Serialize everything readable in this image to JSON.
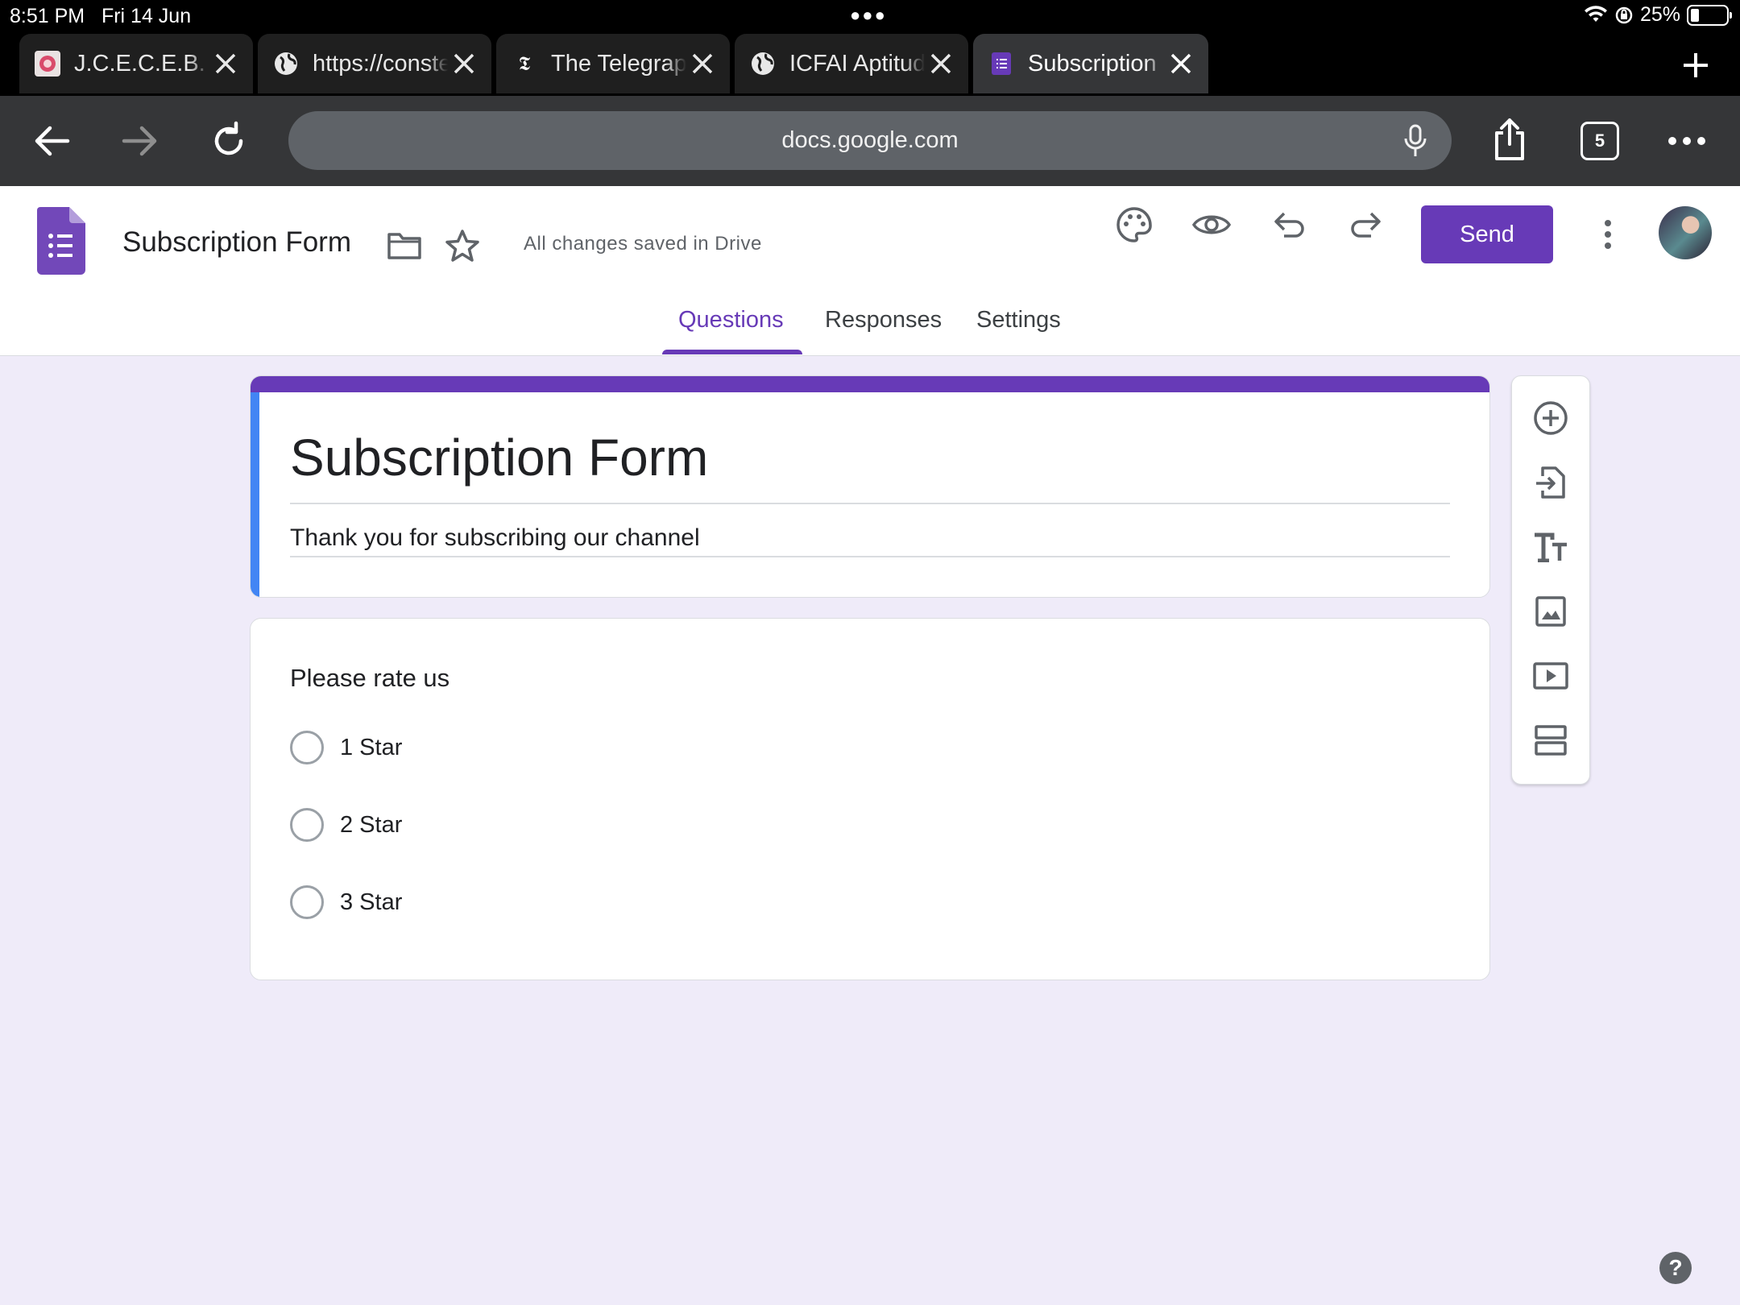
{
  "status_bar": {
    "time": "8:51 PM",
    "date": "Fri 14 Jun",
    "battery": "25%"
  },
  "browser": {
    "tabs": [
      {
        "title": "J.C.E.C.E.B. || Result",
        "icon": "jceceb-favicon"
      },
      {
        "title": "https://constellationtrends",
        "icon": "globe-icon"
      },
      {
        "title": "The Telegraph - Telegraph India",
        "icon": "telegraph-favicon"
      },
      {
        "title": "ICFAI Aptitude Test Result",
        "icon": "globe-icon"
      },
      {
        "title": "Subscription Form - Google Forms",
        "icon": "forms-favicon"
      }
    ],
    "active_tab": 4,
    "url": "docs.google.com",
    "tab_count": "5"
  },
  "header": {
    "doc_title": "Subscription Form",
    "saved_status": "All changes saved in Drive",
    "send_label": "Send",
    "tabs": [
      "Questions",
      "Responses",
      "Settings"
    ],
    "active_tab": "Questions"
  },
  "form": {
    "title": "Subscription Form",
    "description": "Thank you for subscribing our channel",
    "accent_color": "#673ab7",
    "question": {
      "title": "Please rate us",
      "options": [
        "1 Star",
        "2 Star",
        "3 Star"
      ]
    }
  },
  "side_tools": [
    "add-question-icon",
    "import-questions-icon",
    "add-title-icon",
    "add-image-icon",
    "add-video-icon",
    "add-section-icon"
  ],
  "help_label": "?"
}
